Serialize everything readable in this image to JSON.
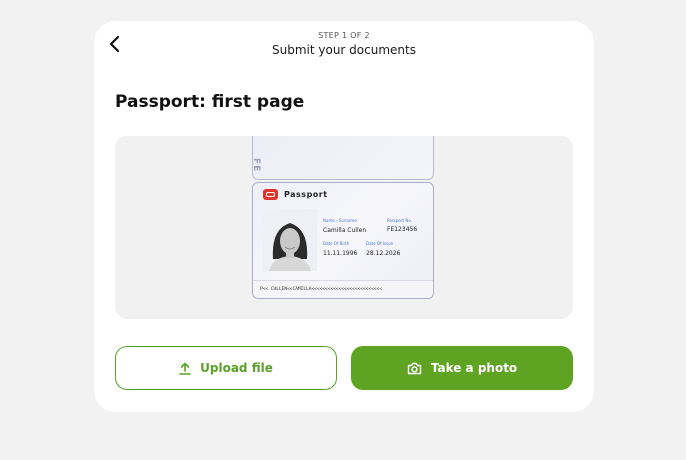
{
  "header": {
    "step": "STEP 1 OF 2",
    "title": "Submit your documents",
    "back_icon": "chevron-left-icon"
  },
  "section": {
    "title": "Passport: first page"
  },
  "passport": {
    "prev_page_text": "FE",
    "title": "Passport",
    "name_label": "Name - Surname",
    "name_value": "Camilla Cullen",
    "number_label": "Passport No.",
    "number_value": "FE123456",
    "dob_label": "Date Of Birth",
    "dob_value": "11.11.1996",
    "doi_label": "Date Of Issue",
    "doi_value": "28.12.2026",
    "mrz": "P<< CULLEN<<CAMILLA<<<<<<<<<<<<<<<<<<<<<<<<<<"
  },
  "actions": {
    "upload_label": "Upload file",
    "upload_icon": "upload-icon",
    "photo_label": "Take a photo",
    "photo_icon": "camera-icon"
  },
  "colors": {
    "accent": "#5fa322",
    "background": "#f2f2f2",
    "card": "#ffffff"
  }
}
